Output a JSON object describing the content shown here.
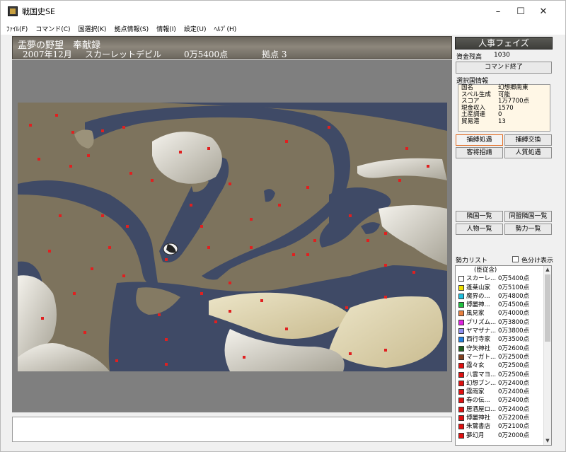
{
  "window": {
    "title": "戦国史SE",
    "minimize": "–",
    "maximize": "☐",
    "close": "✕"
  },
  "menu": [
    "ﾌｧｲﾙ(F)",
    "コマンド(C)",
    "国選択(K)",
    "拠点情報(S)",
    "情報(I)",
    "設定(U)",
    "ﾍﾙﾌﾟ(H)"
  ],
  "header": {
    "title": "盂夢の野望　奉献録",
    "date": "2007年12月",
    "faction": "スカーレットデビル",
    "score": "0万5400点",
    "bases": "拠点 3"
  },
  "right": {
    "phase": "人事フェイズ",
    "funds_label": "資金残高",
    "funds_value": "1030",
    "end_command": "コマンド終了",
    "selected_info_label": "選択国情報",
    "info": [
      {
        "k": "国名",
        "v": "幻想郷南東"
      },
      {
        "k": "スペル生成",
        "v": "可能"
      },
      {
        "k": "スコア",
        "v": "1万7700点"
      },
      {
        "k": "現金収入",
        "v": "1570"
      },
      {
        "k": "土産調達",
        "v": "0"
      },
      {
        "k": "貿易港",
        "v": "13"
      }
    ],
    "buttons": {
      "b1": "捕縛処遇",
      "b2": "捕縛交換",
      "b3": "客将招請",
      "b4": "人質処遇",
      "b5": "隣国一覧",
      "b6": "同盟隣国一覧",
      "b7": "人物一覧",
      "b8": "勢力一覧"
    },
    "faction_list_label": "勢力リスト",
    "color_toggle_label": "色分け表示",
    "list_header": "(臣従含)",
    "factions": [
      {
        "name": "スカーレ...",
        "score": "0万5400点",
        "color": "#ffffff"
      },
      {
        "name": "蓬莱山家",
        "score": "0万5100点",
        "color": "#f0e000"
      },
      {
        "name": "魔界の...",
        "score": "0万4800点",
        "color": "#20c0e0"
      },
      {
        "name": "博麗神...",
        "score": "0万4500点",
        "color": "#20c040"
      },
      {
        "name": "風見家",
        "score": "0万4000点",
        "color": "#e88040"
      },
      {
        "name": "プリズム...",
        "score": "0万3800点",
        "color": "#e020e0"
      },
      {
        "name": "ヤマザナ...",
        "score": "0万3800点",
        "color": "#9090f0"
      },
      {
        "name": "西行寺家",
        "score": "0万3500点",
        "color": "#2080e0"
      },
      {
        "name": "守矢神社",
        "score": "0万2600点",
        "color": "#206020"
      },
      {
        "name": "マーガト...",
        "score": "0万2500点",
        "color": "#804020"
      },
      {
        "name": "霧々玄",
        "score": "0万2500点",
        "color": "#e01010"
      },
      {
        "name": "八雲マヨ...",
        "score": "0万2500点",
        "color": "#e01010"
      },
      {
        "name": "幻想ブン...",
        "score": "0万2400点",
        "color": "#e01010"
      },
      {
        "name": "霧雨家",
        "score": "0万2400点",
        "color": "#e01010"
      },
      {
        "name": "春の伝...",
        "score": "0万2400点",
        "color": "#e01010"
      },
      {
        "name": "居酒屋ロ...",
        "score": "0万2400点",
        "color": "#e01010"
      },
      {
        "name": "博麗神社",
        "score": "0万2200点",
        "color": "#e01010"
      },
      {
        "name": "朱鷺書店",
        "score": "0万2100点",
        "color": "#e01010"
      },
      {
        "name": "夢幻月",
        "score": "0万2000点",
        "color": "#e01010"
      }
    ]
  },
  "colors": {
    "map_land": "#7f7663",
    "map_water": "#3e4a66",
    "map_point": "#e02020"
  }
}
